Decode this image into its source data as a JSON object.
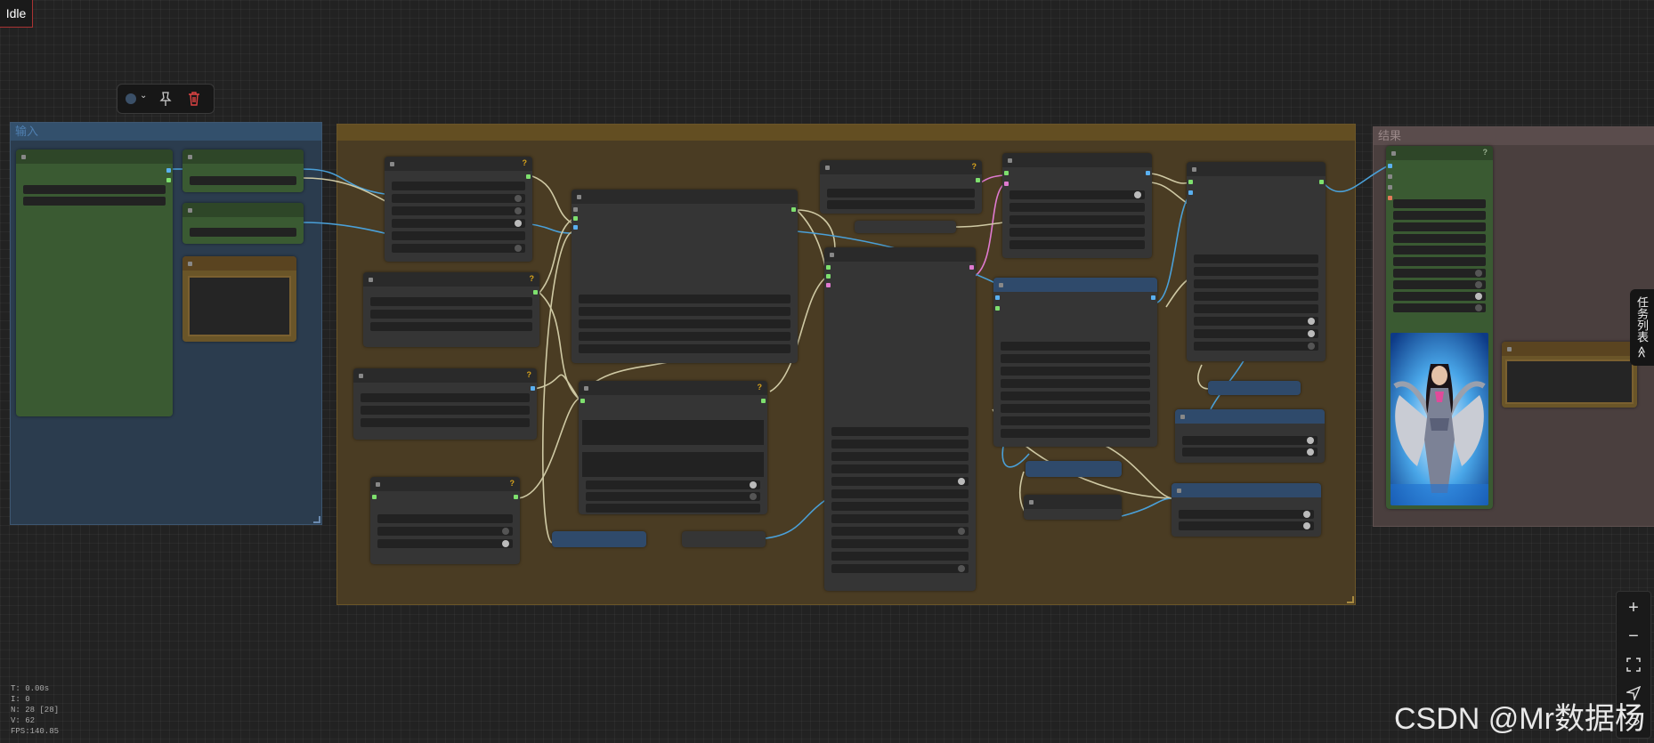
{
  "status": {
    "label": "Idle"
  },
  "toolbar": {
    "color_icon": "color-circle-icon",
    "pin_icon": "pin-icon",
    "delete_icon": "trash-icon"
  },
  "groups": {
    "input": {
      "title": "输入"
    },
    "main": {
      "title": ""
    },
    "result": {
      "title": "结果"
    }
  },
  "side_tab": {
    "label": "任务列表 ≪"
  },
  "zoom": {
    "zoom_in": "+",
    "zoom_out": "−",
    "fit": "fit-screen-icon",
    "locate": "locate-icon"
  },
  "stats": {
    "time": "T: 0.00s",
    "i": "I: 0",
    "nodes": "N: 28 [28]",
    "vertices": "V: 62",
    "fps": "FPS:140.85"
  },
  "watermark": "CSDN @Mr数据杨",
  "colors": {
    "canvas_bg": "#222222",
    "group_input": "#2b3c4e",
    "group_main": "#4a3c23",
    "group_result": "#4a3f3e",
    "node_bg": "#353535",
    "green_node": "#3a5a32",
    "blue_node": "#2f4a6b",
    "link_blue": "#4aa0d8",
    "link_cream": "#cfc9a4",
    "link_pink": "#e07ad0",
    "socket_green": "#7ee06e",
    "socket_blue": "#5ab0f0",
    "warning": "#d9a41c",
    "delete_red": "#e04444"
  }
}
